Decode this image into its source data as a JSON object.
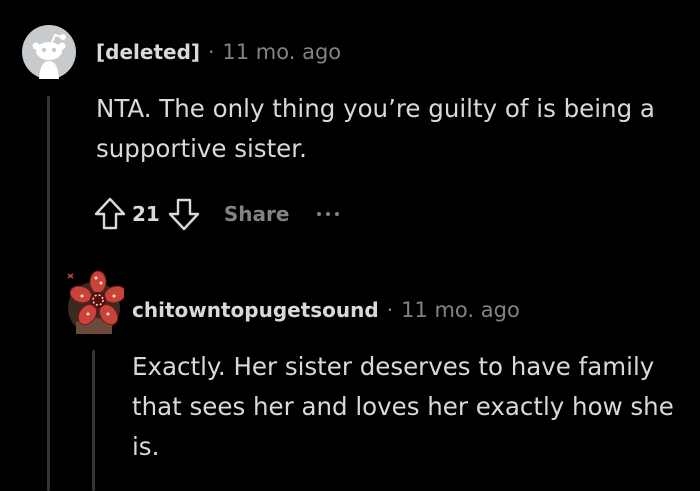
{
  "colors": {
    "background": "#000000",
    "text": "#d7dadc",
    "muted": "#818384",
    "thread_line": "#343536"
  },
  "comment": {
    "author": "[deleted]",
    "separator": "·",
    "time": "11 mo. ago",
    "body": "NTA. The only thing you’re guilty of is being a supportive sister.",
    "score": "21",
    "share_label": "Share",
    "icons": {
      "avatar": "reddit-snoo-avatar-icon",
      "upvote": "upvote-arrow-icon",
      "downvote": "downvote-arrow-icon",
      "more": "more-options-icon"
    }
  },
  "reply": {
    "author": "chitowntopugetsound",
    "separator": "·",
    "time": "11 mo. ago",
    "body": "Exactly. Her sister deserves to have family that sees her and loves her exactly how she is.",
    "icons": {
      "avatar": "user-avatar-icon"
    }
  }
}
